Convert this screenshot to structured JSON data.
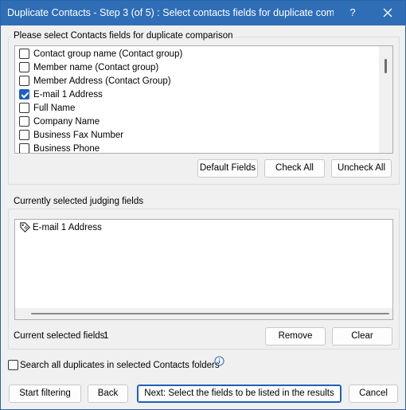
{
  "window": {
    "title": "Duplicate Contacts - Step 3 (of 5) : Select contacts fields for duplicate comp...",
    "help_label": "?"
  },
  "fields_group": {
    "label": "Please select Contacts fields for duplicate comparison",
    "items": [
      {
        "label": "Contact group name (Contact group)",
        "checked": false
      },
      {
        "label": "Member name (Contact group)",
        "checked": false
      },
      {
        "label": "Member Address (Contact Group)",
        "checked": false
      },
      {
        "label": "E-mail 1 Address",
        "checked": true
      },
      {
        "label": "Full Name",
        "checked": false
      },
      {
        "label": "Company Name",
        "checked": false
      },
      {
        "label": "Business Fax Number",
        "checked": false
      },
      {
        "label": "Business Phone",
        "checked": false
      }
    ],
    "buttons": {
      "default_fields": "Default Fields",
      "check_all": "Check All",
      "uncheck_all": "Uncheck All"
    }
  },
  "judging_group": {
    "label": "Currently selected judging fields",
    "items": [
      "E-mail 1 Address"
    ],
    "count_label": "Current selected fields:",
    "count_value": "1",
    "buttons": {
      "remove": "Remove",
      "clear": "Clear"
    }
  },
  "search_all": {
    "label": "Search all duplicates in selected Contacts folders",
    "checked": false
  },
  "footer": {
    "start_filtering": "Start filtering",
    "back": "Back",
    "next": "Next: Select the fields to be listed in the results",
    "cancel": "Cancel"
  },
  "colors": {
    "titlebar": "#2f6db7",
    "accent": "#1f5fbf",
    "background": "#f0f0f0"
  },
  "icons": {
    "close": "close-icon",
    "help": "help-icon",
    "field_tag": "tag-icon",
    "info": "info-icon"
  }
}
